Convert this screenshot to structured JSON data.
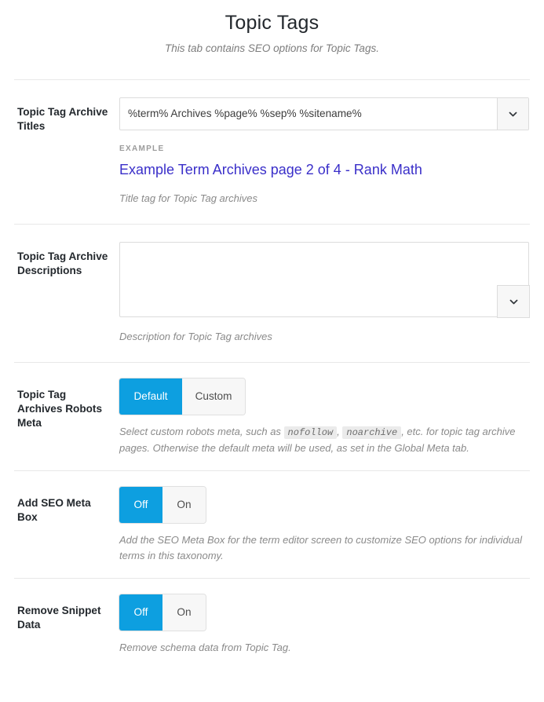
{
  "header": {
    "title": "Topic Tags",
    "subtitle": "This tab contains SEO options for Topic Tags."
  },
  "colors": {
    "accent": "#0d9fe0",
    "example_link": "#3a2fc9",
    "help_text": "#8a8a8a",
    "divider": "#e8e8e8"
  },
  "settings": {
    "archive_titles": {
      "label": "Topic Tag Archive Titles",
      "value": "%term% Archives %page% %sep% %sitename%",
      "placeholder": "",
      "dropdown_icon": "chevron-down-icon",
      "example_label": "EXAMPLE",
      "example_value": "Example Term Archives page 2 of 4 - Rank Math",
      "help": "Title tag for Topic Tag archives"
    },
    "archive_descriptions": {
      "label": "Topic Tag Archive Descriptions",
      "value": "",
      "placeholder": "",
      "dropdown_icon": "chevron-down-icon",
      "help": "Description for Topic Tag archives"
    },
    "robots_meta": {
      "label": "Topic Tag Archives Robots Meta",
      "options": [
        "Default",
        "Custom"
      ],
      "selected": "Default",
      "help_part1": "Select custom robots meta, such as ",
      "help_code1": "nofollow",
      "help_part2": ", ",
      "help_code2": "noarchive",
      "help_part3": ", etc. for topic tag archive pages. Otherwise the default meta will be used, as set in the Global Meta tab."
    },
    "add_seo_meta_box": {
      "label": "Add SEO Meta Box",
      "options": [
        "Off",
        "On"
      ],
      "selected": "Off",
      "help": "Add the SEO Meta Box for the term editor screen to customize SEO options for individual terms in this taxonomy."
    },
    "remove_snippet_data": {
      "label": "Remove Snippet Data",
      "options": [
        "Off",
        "On"
      ],
      "selected": "Off",
      "help": "Remove schema data from Topic Tag."
    }
  }
}
